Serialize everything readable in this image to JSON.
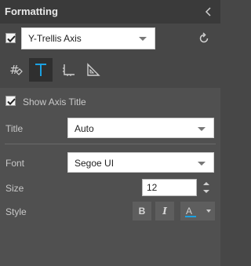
{
  "header": {
    "title": "Formatting"
  },
  "axis": {
    "checked": true,
    "selected": "Y-Trellis Axis"
  },
  "tabs": [
    {
      "name": "tab-general",
      "icon": "format-icon"
    },
    {
      "name": "tab-text",
      "icon": "text-icon",
      "active": true
    },
    {
      "name": "tab-axis",
      "icon": "axis-icon"
    },
    {
      "name": "tab-scale",
      "icon": "triangle-ruler-icon"
    }
  ],
  "show_axis_title": {
    "label": "Show Axis Title",
    "checked": true
  },
  "title": {
    "label": "Title",
    "value": "Auto"
  },
  "font": {
    "label": "Font",
    "value": "Segoe UI"
  },
  "size": {
    "label": "Size",
    "value": "12"
  },
  "style": {
    "label": "Style",
    "bold": "B",
    "italic": "I",
    "color_letter": "A"
  },
  "colors": {
    "accent": "#1ba1e2",
    "panel_bg": "#474747",
    "header_bg": "#3a3a3a"
  }
}
